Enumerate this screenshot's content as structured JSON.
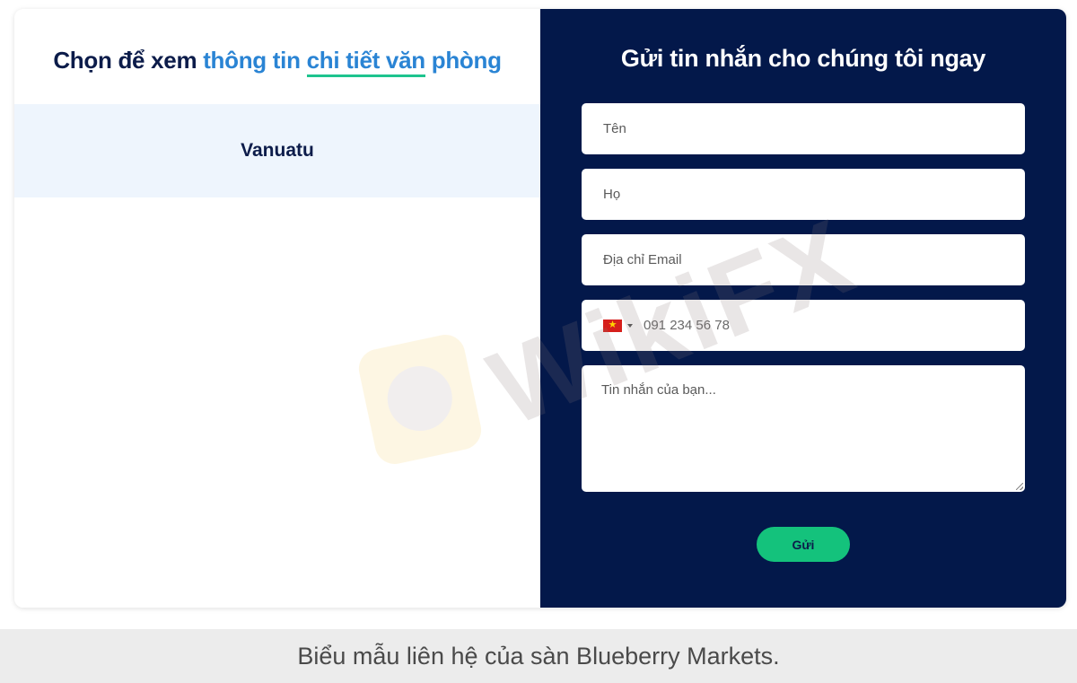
{
  "left": {
    "title_part1": "Chọn để xem ",
    "title_part2": "thông tin ",
    "title_part3": "chi tiết văn",
    "title_part4": " phòng",
    "office_tab": "Vanuatu"
  },
  "form": {
    "title": "Gửi tin nhắn cho chúng tôi ngay",
    "first_name_placeholder": "Tên",
    "last_name_placeholder": "Họ",
    "email_placeholder": "Địa chỉ Email",
    "phone_placeholder": "091 234 56 78",
    "message_placeholder": "Tin nhắn của bạn...",
    "submit_label": "Gửi",
    "country_flag_icon": "vietnam-flag-icon"
  },
  "watermark": {
    "text": "WikiFX"
  },
  "caption": "Biểu mẫu liên hệ của sàn Blueberry Markets.",
  "colors": {
    "navy": "#03184a",
    "accent_blue": "#2a84d4",
    "accent_green": "#14c27c",
    "tab_bg": "#eef5fd"
  }
}
